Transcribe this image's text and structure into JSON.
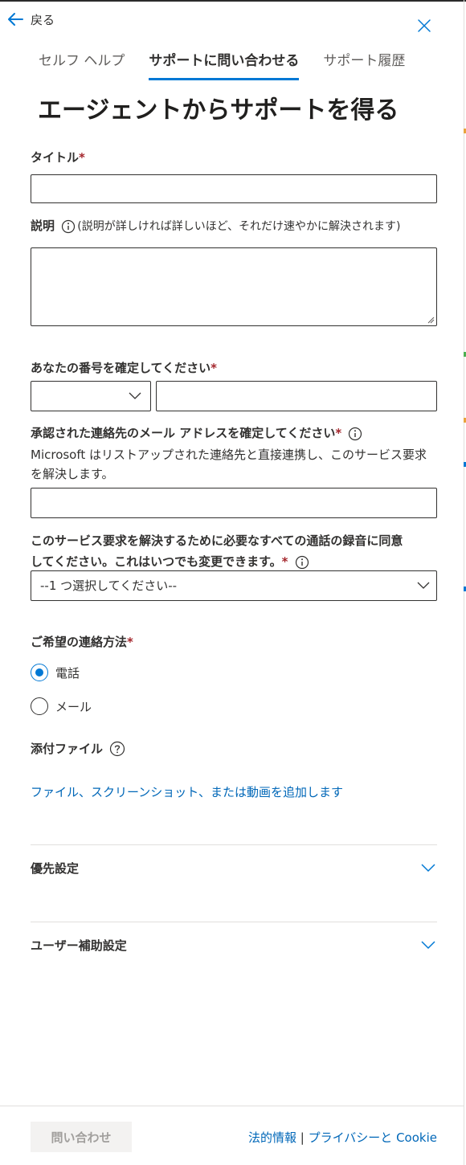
{
  "nav": {
    "back_label": "戻る"
  },
  "tabs": [
    {
      "label": "セルフ ヘルプ"
    },
    {
      "label": "サポートに問い合わせる"
    },
    {
      "label": "サポート履歴"
    }
  ],
  "page_title": "エージェントからサポートを得る",
  "form": {
    "title_label": "タイトル",
    "title_value": "",
    "description_label": "説明",
    "description_note": "(説明が詳しければ詳しいほど、それだけ速やかに解決されます)",
    "description_value": "",
    "phone_label": "あなたの番号を確定してください",
    "country_code_value": "",
    "phone_value": "",
    "email_label": "承認された連絡先のメール アドレスを確定してください",
    "email_help": "Microsoft はリストアップされた連絡先と直接連携し、このサービス要求を解決します。",
    "email_value": "",
    "consent_label_line1": "このサービス要求を解決するために必要なすべての通話の録音に同意",
    "consent_label_line2": "してください。これはいつでも変更できます。",
    "consent_select_value": "--1 つ選択してください--",
    "contact_method_label": "ご希望の連絡方法",
    "contact_options": [
      {
        "label": "電話",
        "selected": true
      },
      {
        "label": "メール",
        "selected": false
      }
    ],
    "attachment_label": "添付ファイル",
    "attachment_link": "ファイル、スクリーンショット、または動画を追加します",
    "required_mark": "*"
  },
  "sections": [
    {
      "label": "優先設定"
    },
    {
      "label": "ユーザー補助設定"
    }
  ],
  "footer": {
    "submit_label": "問い合わせ",
    "legal_link": "法的情報",
    "separator": "|",
    "privacy_link": "プライバシーと Cookie"
  },
  "colors": {
    "accent": "#0078d4",
    "link": "#0067b8",
    "required": "#a4262c",
    "disabled_bg": "#f3f2f1",
    "disabled_text": "#a19f9d"
  }
}
